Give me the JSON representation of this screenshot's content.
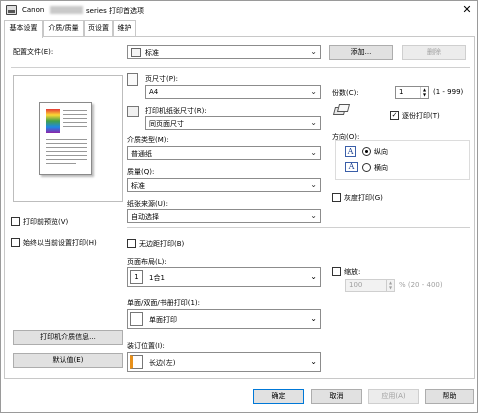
{
  "window": {
    "title_prefix": "Canon",
    "title_suffix": "series 打印首选项",
    "close_glyph": "✕"
  },
  "tabs": [
    {
      "label": "基本设置",
      "active": true
    },
    {
      "label": "介质/质量",
      "active": false
    },
    {
      "label": "页设置",
      "active": false
    },
    {
      "label": "维护",
      "active": false
    }
  ],
  "profile": {
    "label": "配置文件(E):",
    "value": "标准",
    "add_label": "添加...",
    "delete_label": "删除"
  },
  "left": {
    "preview_before_print_label": "打印前预览(V)",
    "preview_before_print_checked": false,
    "always_print_current_label": "始终以当前设置打印(H)",
    "always_print_current_checked": false,
    "media_info_button": "打印机介质信息...",
    "defaults_button": "默认值(E)"
  },
  "page_size": {
    "label": "页尺寸(P):",
    "value": "A4"
  },
  "printer_paper_size": {
    "label": "打印机纸张尺寸(R):",
    "value": "同页面尺寸"
  },
  "media_type": {
    "label": "介质类型(M):",
    "value": "普通纸"
  },
  "quality": {
    "label": "质量(Q):",
    "value": "标准"
  },
  "paper_source": {
    "label": "纸张来源(U):",
    "value": "自动选择"
  },
  "copies": {
    "label": "份数(C):",
    "value": "1",
    "range": "(1 - 999)",
    "collate_label": "逐份打印(T)",
    "collate_checked": true
  },
  "orientation": {
    "label": "方向(O):",
    "portrait_label": "纵向",
    "landscape_label": "横向",
    "selected": "portrait",
    "icon_glyph": "A"
  },
  "grayscale": {
    "label": "灰度打印(G)",
    "checked": false
  },
  "borderless": {
    "label": "无边距打印(B)",
    "checked": false
  },
  "page_layout": {
    "label": "页面布局(L):",
    "value": "1合1",
    "icon_glyph": "1"
  },
  "duplex": {
    "label": "单面/双面/书册打印(1):",
    "value": "单面打印"
  },
  "stapling": {
    "label": "装订位置(I):",
    "value": "长边(左)"
  },
  "scaling": {
    "label": "缩放:",
    "checked": false,
    "value": "100",
    "range": "% (20 - 400)"
  },
  "footer": {
    "ok": "确定",
    "cancel": "取消",
    "apply": "应用(A)",
    "help": "帮助"
  },
  "colors": {
    "accent": "#0078d7",
    "disabled_text": "#a0a0a0"
  }
}
